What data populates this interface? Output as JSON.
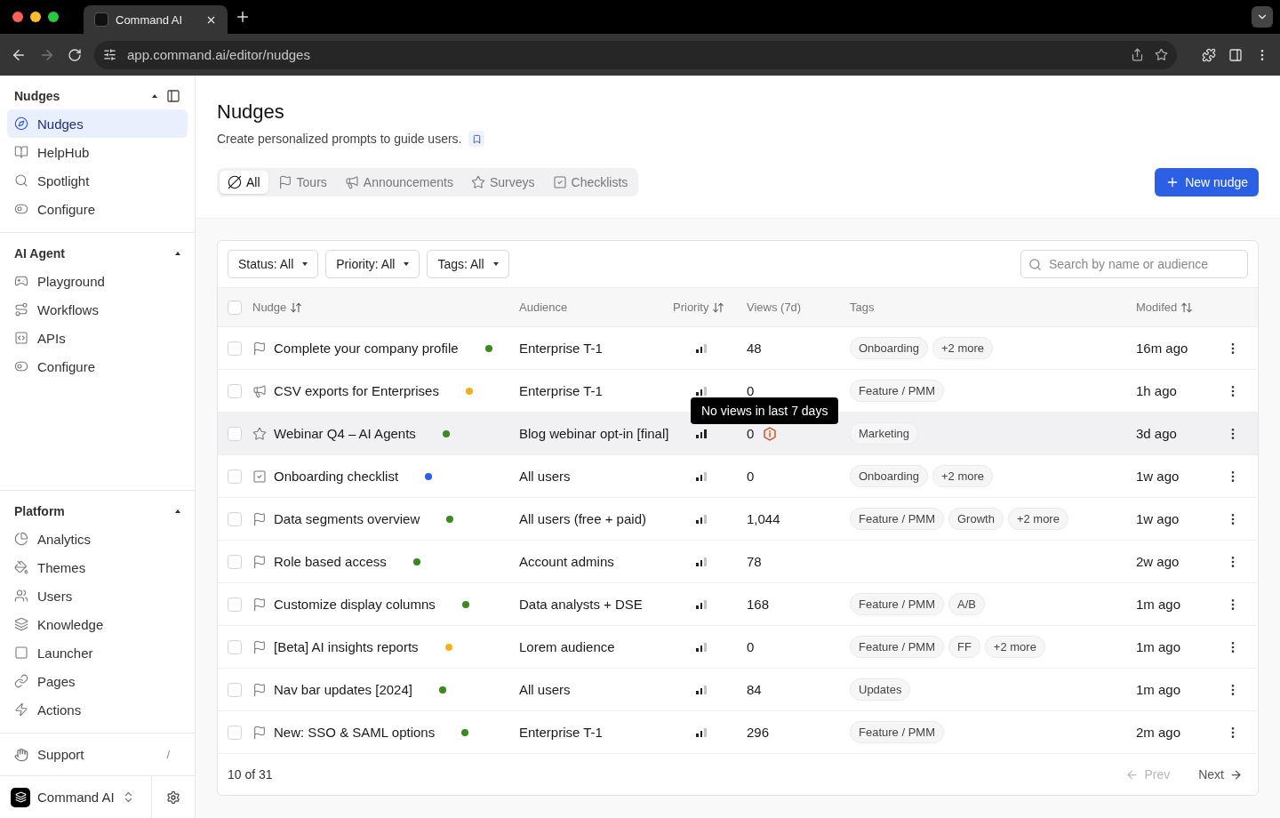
{
  "browser": {
    "tab_title": "Command AI",
    "url": "app.command.ai/editor/nudges"
  },
  "sidebar": {
    "sections": [
      {
        "title": "Nudges",
        "expanded": true,
        "items": [
          {
            "label": "Nudges",
            "kind": "nudges",
            "selected": true
          },
          {
            "label": "HelpHub",
            "kind": "helphub",
            "selected": false
          },
          {
            "label": "Spotlight",
            "kind": "spotlight",
            "selected": false
          },
          {
            "label": "Configure",
            "kind": "configure",
            "selected": false
          }
        ]
      },
      {
        "title": "AI Agent",
        "expanded": true,
        "items": [
          {
            "label": "Playground",
            "kind": "playground",
            "selected": false
          },
          {
            "label": "Workflows",
            "kind": "workflows",
            "selected": false
          },
          {
            "label": "APIs",
            "kind": "apis",
            "selected": false
          },
          {
            "label": "Configure",
            "kind": "configure",
            "selected": false
          }
        ]
      },
      {
        "title": "Platform",
        "expanded": true,
        "items": [
          {
            "label": "Analytics",
            "kind": "analytics",
            "selected": false
          },
          {
            "label": "Themes",
            "kind": "themes",
            "selected": false
          },
          {
            "label": "Users",
            "kind": "users",
            "selected": false
          },
          {
            "label": "Knowledge",
            "kind": "knowledge",
            "selected": false
          },
          {
            "label": "Launcher",
            "kind": "launcher",
            "selected": false
          },
          {
            "label": "Pages",
            "kind": "pages",
            "selected": false
          },
          {
            "label": "Actions",
            "kind": "actions",
            "selected": false
          }
        ]
      }
    ],
    "support": {
      "label": "Support",
      "shortcut": "/"
    },
    "workspace": "Command AI"
  },
  "page": {
    "title": "Nudges",
    "subtitle": "Create personalized prompts to guide users.",
    "tabs": [
      {
        "label": "All",
        "kind": "all",
        "selected": true
      },
      {
        "label": "Tours",
        "kind": "tour",
        "selected": false
      },
      {
        "label": "Announcements",
        "kind": "announcement",
        "selected": false
      },
      {
        "label": "Surveys",
        "kind": "survey",
        "selected": false
      },
      {
        "label": "Checklists",
        "kind": "checklist",
        "selected": false
      }
    ],
    "new_button": "New nudge"
  },
  "filters": [
    {
      "label": "Status: All"
    },
    {
      "label": "Priority: All"
    },
    {
      "label": "Tags: All"
    }
  ],
  "search": {
    "placeholder": "Search by name or audience"
  },
  "table": {
    "select_all_checked": false,
    "columns": [
      {
        "label": "Nudge",
        "sortable": true
      },
      {
        "label": "Audience",
        "sortable": false
      },
      {
        "label": "Priority",
        "sortable": true
      },
      {
        "label": "Views (7d)",
        "sortable": false
      },
      {
        "label": "Tags",
        "sortable": false
      },
      {
        "label": "Modifed",
        "sortable": true
      }
    ],
    "rows": [
      {
        "kind": "tour",
        "name": "Complete your company profile",
        "color": "#3a8a1f",
        "audience": "Enterprise T-1",
        "high_priority": false,
        "views": "48",
        "alert": false,
        "tags": [
          "Onboarding",
          "+2 more"
        ],
        "modified": "16m ago",
        "hovered": false,
        "checked": false
      },
      {
        "kind": "announcement",
        "name": "CSV exports for Enterprises",
        "color": "#f0b21c",
        "audience": "Enterprise T-1",
        "high_priority": false,
        "views": "0",
        "alert": false,
        "tags": [
          "Feature / PMM"
        ],
        "modified": "1h ago",
        "hovered": false,
        "checked": false
      },
      {
        "kind": "survey",
        "name": "Webinar Q4 – AI Agents",
        "color": "#3a8a1f",
        "audience": "Blog webinar opt-in [final]",
        "high_priority": true,
        "views": "0",
        "alert": true,
        "tooltip": "No views in last 7 days",
        "tags": [
          "Marketing"
        ],
        "modified": "3d ago",
        "hovered": true,
        "checked": false
      },
      {
        "kind": "checklist",
        "name": "Onboarding checklist",
        "color": "#2f5fe8",
        "audience": "All users",
        "high_priority": false,
        "views": "0",
        "alert": false,
        "tags": [
          "Onboarding",
          "+2 more"
        ],
        "modified": "1w ago",
        "hovered": false,
        "checked": false
      },
      {
        "kind": "tour",
        "name": "Data segments overview",
        "color": "#3a8a1f",
        "audience": "All users (free + paid)",
        "high_priority": false,
        "views": "1,044",
        "alert": false,
        "tags": [
          "Feature / PMM",
          "Growth",
          "+2 more"
        ],
        "modified": "1w ago",
        "hovered": false,
        "checked": false
      },
      {
        "kind": "tour",
        "name": "Role based access",
        "color": "#3a8a1f",
        "audience": "Account admins",
        "high_priority": false,
        "views": "78",
        "alert": false,
        "tags": [],
        "modified": "2w ago",
        "hovered": false,
        "checked": false
      },
      {
        "kind": "tour",
        "name": "Customize display columns",
        "color": "#3a8a1f",
        "audience": "Data analysts + DSE",
        "high_priority": false,
        "views": "168",
        "alert": false,
        "tags": [
          "Feature / PMM",
          "A/B"
        ],
        "modified": "1m ago",
        "hovered": false,
        "checked": false
      },
      {
        "kind": "tour",
        "name": "[Beta] AI insights reports",
        "color": "#f0b21c",
        "audience": "Lorem audience",
        "high_priority": false,
        "views": "0",
        "alert": false,
        "tags": [
          "Feature / PMM",
          "FF",
          "+2 more"
        ],
        "modified": "1m ago",
        "hovered": false,
        "checked": false
      },
      {
        "kind": "tour",
        "name": "Nav bar updates [2024]",
        "color": "#3a8a1f",
        "audience": "All users",
        "high_priority": false,
        "views": "84",
        "alert": false,
        "tags": [
          "Updates"
        ],
        "modified": "1m ago",
        "hovered": false,
        "checked": false
      },
      {
        "kind": "tour",
        "name": "New: SSO & SAML options",
        "color": "#3a8a1f",
        "audience": "Enterprise T-1",
        "high_priority": false,
        "views": "296",
        "alert": false,
        "tags": [
          "Feature / PMM"
        ],
        "modified": "2m ago",
        "hovered": false,
        "checked": false
      }
    ]
  },
  "pagination": {
    "count": "10 of 31",
    "prev": "Prev",
    "next": "Next",
    "prev_disabled": true
  }
}
